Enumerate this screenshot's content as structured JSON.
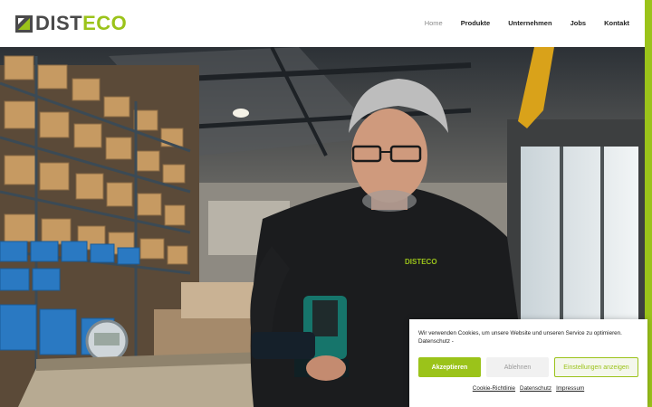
{
  "brand": {
    "name_part1": "DIST",
    "name_part2": "ECO",
    "accent_color": "#9bc31a",
    "logo_icon": "disteco-logo-icon"
  },
  "nav": {
    "items": [
      {
        "label": "Home",
        "active": true
      },
      {
        "label": "Produkte",
        "active": false
      },
      {
        "label": "Unternehmen",
        "active": false
      },
      {
        "label": "Jobs",
        "active": false
      },
      {
        "label": "Kontakt",
        "active": false
      }
    ]
  },
  "hero": {
    "image": "warehouse-worker-photo",
    "shirt_print": "DISTECO"
  },
  "cookie": {
    "text": "Wir verwenden Cookies, um unsere Website und unseren Service zu optimieren.",
    "privacy_inline_link": "Datenschutz",
    "privacy_suffix": " -",
    "accept_label": "Akzeptieren",
    "deny_label": "Ablehnen",
    "settings_label": "Einstellungen anzeigen",
    "links": [
      "Cookie-Richtlinie",
      "Datenschutz",
      "Impressum"
    ]
  }
}
